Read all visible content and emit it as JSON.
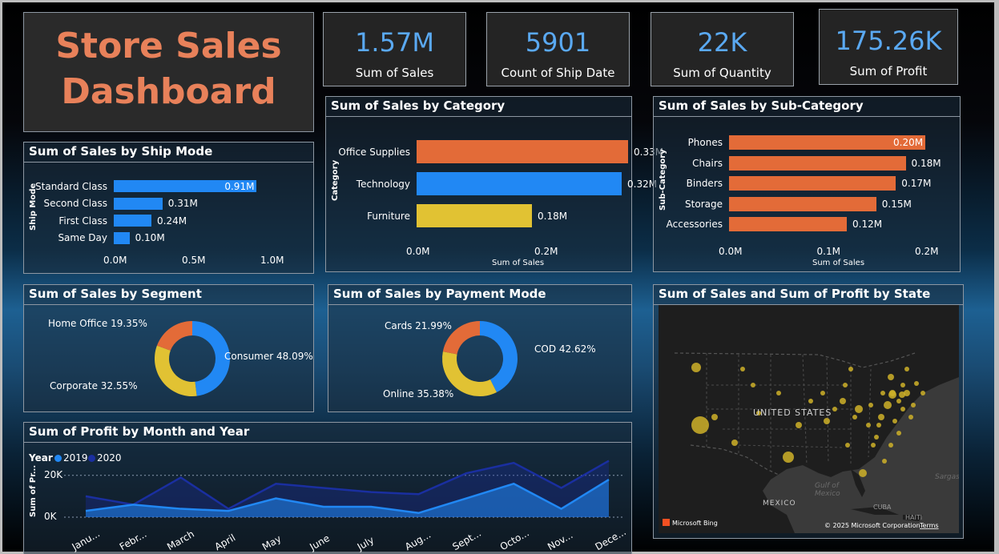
{
  "title": "Store Sales Dashboard",
  "title_line1": "Store Sales",
  "title_line2": "Dashboard",
  "colors": {
    "orange": "#e36b38",
    "blue": "#2188f4",
    "yellow": "#e1c233",
    "navy": "#1a2fa0",
    "title": "#e8815a",
    "kpi": "#5aa9f2"
  },
  "kpis": [
    {
      "value": "1.57M",
      "label": "Sum of Sales"
    },
    {
      "value": "5901",
      "label": "Count of Ship Date"
    },
    {
      "value": "22K",
      "label": "Sum of Quantity"
    },
    {
      "value": "175.26K",
      "label": "Sum of Profit"
    }
  ],
  "chart_data": [
    {
      "type": "bar",
      "title": "Sum of Sales by Ship Mode",
      "ylabel": "Ship Mode",
      "categories": [
        "Standard Class",
        "Second Class",
        "First Class",
        "Same Day"
      ],
      "values": [
        0.91,
        0.31,
        0.24,
        0.1
      ],
      "data_labels": [
        "0.91M",
        "0.31M",
        "0.24M",
        "0.10M"
      ],
      "ticks": [
        "0.0M",
        "0.5M",
        "1.0M"
      ],
      "xlim": [
        0,
        1.0
      ]
    },
    {
      "type": "bar",
      "title": "Sum of Sales by Category",
      "ylabel": "Category",
      "xlabel": "Sum of Sales",
      "categories": [
        "Office Supplies",
        "Technology",
        "Furniture"
      ],
      "values": [
        0.33,
        0.32,
        0.18
      ],
      "data_labels": [
        "0.33M",
        "0.32M",
        "0.18M"
      ],
      "ticks": [
        "0.0M",
        "0.2M"
      ],
      "xlim": [
        0,
        0.4
      ]
    },
    {
      "type": "bar",
      "title": "Sum of Sales by Sub-Category",
      "ylabel": "Sub-Category",
      "xlabel": "Sum of Sales",
      "categories": [
        "Phones",
        "Chairs",
        "Binders",
        "Storage",
        "Accessories"
      ],
      "values": [
        0.2,
        0.18,
        0.17,
        0.15,
        0.12
      ],
      "data_labels": [
        "0.20M",
        "0.18M",
        "0.17M",
        "0.15M",
        "0.12M"
      ],
      "ticks": [
        "0.0M",
        "0.1M",
        "0.2M"
      ],
      "xlim": [
        0,
        0.2
      ]
    },
    {
      "type": "pie",
      "title": "Sum of Sales by Segment",
      "labels": [
        "Consumer",
        "Corporate",
        "Home Office"
      ],
      "values": [
        48.09,
        32.55,
        19.35
      ],
      "data_labels": [
        "Consumer 48.09%",
        "Corporate 32.55%",
        "Home Office 19.35%"
      ]
    },
    {
      "type": "pie",
      "title": "Sum of Sales by Payment Mode",
      "labels": [
        "COD",
        "Online",
        "Cards"
      ],
      "values": [
        42.62,
        35.38,
        21.99
      ],
      "data_labels": [
        "COD 42.62%",
        "Online 35.38%",
        "Cards 21.99%"
      ]
    },
    {
      "type": "area",
      "title": "Sum of Profit by Month and Year",
      "ylabel": "Sum of Pr...",
      "legend_title": "Year",
      "x": [
        "Janu...",
        "Febr...",
        "March",
        "April",
        "May",
        "June",
        "July",
        "Aug...",
        "Sept...",
        "Octo...",
        "Nov...",
        "Dece..."
      ],
      "series": [
        {
          "name": "2019",
          "values": [
            3000,
            6000,
            4000,
            3000,
            9000,
            5000,
            5000,
            2000,
            9000,
            16000,
            4000,
            18000
          ]
        },
        {
          "name": "2020",
          "values": [
            10000,
            6000,
            19000,
            4000,
            16000,
            14000,
            12000,
            11000,
            21000,
            26000,
            14000,
            27000
          ]
        }
      ],
      "ticks": [
        "0K",
        "20K"
      ],
      "ylim": [
        0,
        30000
      ]
    }
  ],
  "map": {
    "title": "Sum of Sales and Sum of Profit by State",
    "country_label": "UNITED STATES",
    "labels": [
      "MEXICO",
      "CUBA",
      "HAITI",
      "Gulf of",
      "Mexico",
      "Sargas"
    ],
    "attribution": "Microsoft Bing",
    "copyright": "© 2025 Microsoft Corporation",
    "terms": "Terms"
  }
}
